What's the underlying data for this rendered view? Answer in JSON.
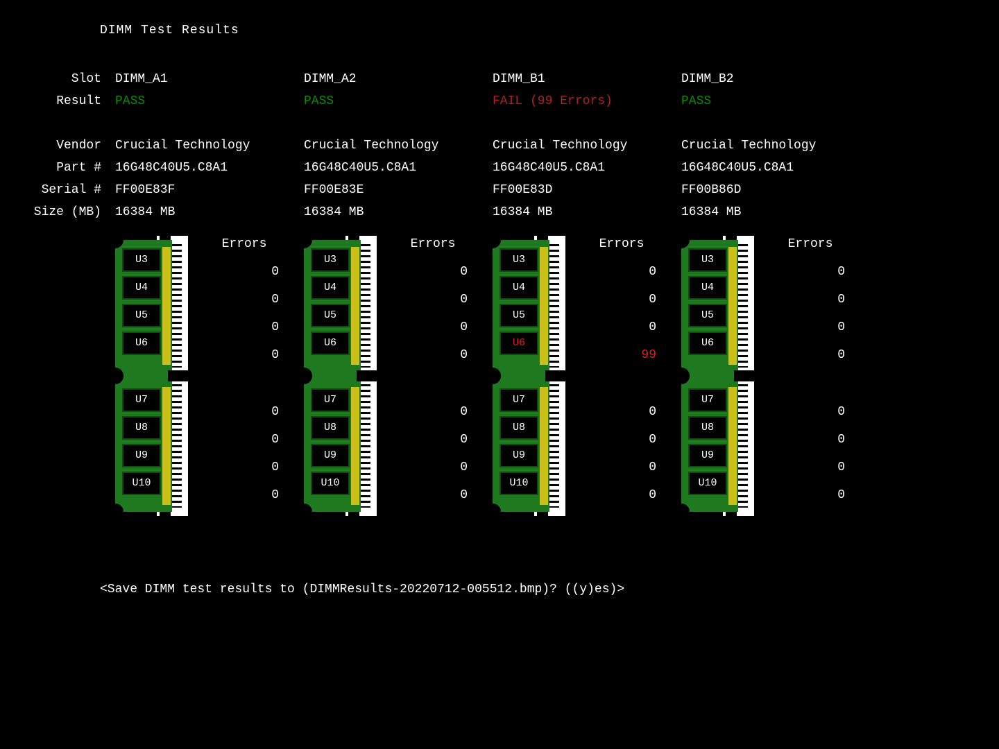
{
  "title": "DIMM Test Results",
  "row_labels": {
    "slot": "Slot",
    "result": "Result",
    "vendor": "Vendor",
    "part": "Part #",
    "serial": "Serial #",
    "size": "Size (MB)"
  },
  "errors_header": "Errors",
  "chip_labels": [
    "U3",
    "U4",
    "U5",
    "U6",
    "U7",
    "U8",
    "U9",
    "U10"
  ],
  "dimms": [
    {
      "slot": "DIMM_A1",
      "result_text": "PASS",
      "result_status": "pass",
      "vendor": "Crucial Technology",
      "part": "16G48C40U5.C8A1",
      "serial": "FF00E83F",
      "size": "16384 MB",
      "chip_errors": [
        0,
        0,
        0,
        0,
        0,
        0,
        0,
        0
      ]
    },
    {
      "slot": "DIMM_A2",
      "result_text": "PASS",
      "result_status": "pass",
      "vendor": "Crucial Technology",
      "part": "16G48C40U5.C8A1",
      "serial": "FF00E83E",
      "size": "16384 MB",
      "chip_errors": [
        0,
        0,
        0,
        0,
        0,
        0,
        0,
        0
      ]
    },
    {
      "slot": "DIMM_B1",
      "result_text": "FAIL (99 Errors)",
      "result_status": "fail",
      "vendor": "Crucial Technology",
      "part": "16G48C40U5.C8A1",
      "serial": "FF00E83D",
      "size": "16384 MB",
      "chip_errors": [
        0,
        0,
        0,
        99,
        0,
        0,
        0,
        0
      ]
    },
    {
      "slot": "DIMM_B2",
      "result_text": "PASS",
      "result_status": "pass",
      "vendor": "Crucial Technology",
      "part": "16G48C40U5.C8A1",
      "serial": "FF00B86D",
      "size": "16384 MB",
      "chip_errors": [
        0,
        0,
        0,
        0,
        0,
        0,
        0,
        0
      ]
    }
  ],
  "prompt": "<Save DIMM test results to (DIMMResults-20220712-005512.bmp)? ((y)es)>"
}
